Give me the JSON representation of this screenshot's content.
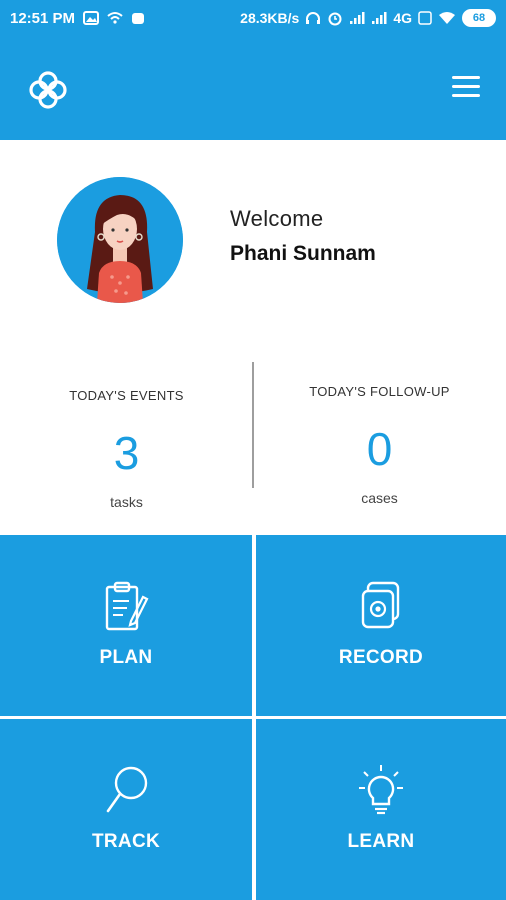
{
  "status_bar": {
    "time": "12:51 PM",
    "speed": "28.3KB/s",
    "network": "4G",
    "battery": "68"
  },
  "app_bar": {
    "logo_icon": "clover-logo-icon",
    "menu_icon": "hamburger-menu-icon"
  },
  "profile": {
    "welcome": "Welcome",
    "name": "Phani Sunnam"
  },
  "stats": {
    "events": {
      "label": "TODAY'S EVENTS",
      "value": "3",
      "unit": "tasks"
    },
    "followup": {
      "label": "TODAY'S FOLLOW-UP",
      "value": "0",
      "unit": "cases"
    }
  },
  "tiles": [
    {
      "label": "PLAN",
      "icon": "clipboard-pen-icon"
    },
    {
      "label": "RECORD",
      "icon": "record-stack-icon"
    },
    {
      "label": "TRACK",
      "icon": "magnifier-icon"
    },
    {
      "label": "LEARN",
      "icon": "lightbulb-icon"
    }
  ],
  "colors": {
    "primary": "#1b9de0",
    "background": "#ffffff",
    "divider": "#9e9e9e"
  }
}
